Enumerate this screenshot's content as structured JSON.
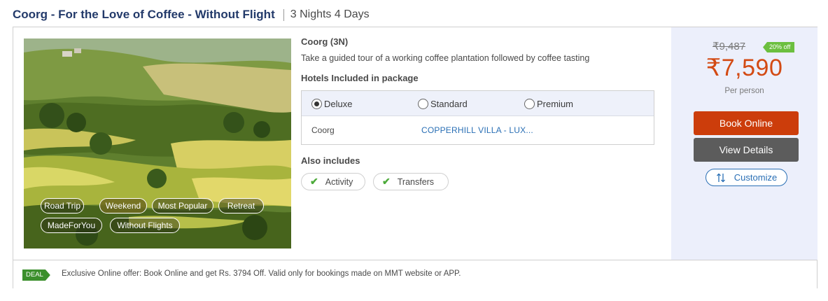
{
  "package": {
    "title": "Coorg - For the Love of Coffee - Without Flight",
    "duration": "3 Nights 4 Days"
  },
  "image": {
    "tags": [
      {
        "label": "Road Trip",
        "highlighted": false
      },
      {
        "label": "Weekend",
        "highlighted": true
      },
      {
        "label": "Most Popular",
        "highlighted": false
      },
      {
        "label": "Retreat",
        "highlighted": false
      },
      {
        "label": "MadeForYou",
        "highlighted": false
      },
      {
        "label": "Without Flights",
        "highlighted": false
      }
    ]
  },
  "details": {
    "destination": "Coorg (3N)",
    "description": "Take a guided tour of a working coffee plantation followed by coffee tasting",
    "hotels_heading": "Hotels Included in package",
    "hotel_options": [
      {
        "label": "Deluxe",
        "selected": true
      },
      {
        "label": "Standard",
        "selected": false
      },
      {
        "label": "Premium",
        "selected": false
      }
    ],
    "hotel_row": {
      "city": "Coorg",
      "hotel": "COPPERHILL VILLA - LUX..."
    },
    "also_includes_heading": "Also includes",
    "includes": [
      {
        "label": "Activity",
        "icon": "check-icon"
      },
      {
        "label": "Transfers",
        "icon": "check-icon"
      }
    ]
  },
  "pricing": {
    "old_price": "₹9,487",
    "discount": "20% off",
    "price": "₹7,590",
    "per_person": "Per person",
    "book_label": "Book Online",
    "view_label": "View Details",
    "customize_label": "Customize",
    "customize_icon": "sliders-icon"
  },
  "deal": {
    "badge": "DEAL",
    "text": "Exclusive Online offer: Book Online and get Rs. 3794 Off. Valid only for bookings made on MMT website or APP."
  },
  "colors": {
    "title": "#233a6a",
    "price": "#d34a13",
    "book_button": "#cc3d0b",
    "view_button": "#5c5c5c",
    "link": "#2a6fb5",
    "discount_badge": "#6cbf3f",
    "deal_badge": "#3b8f2c",
    "price_panel_bg": "#eceffb"
  }
}
